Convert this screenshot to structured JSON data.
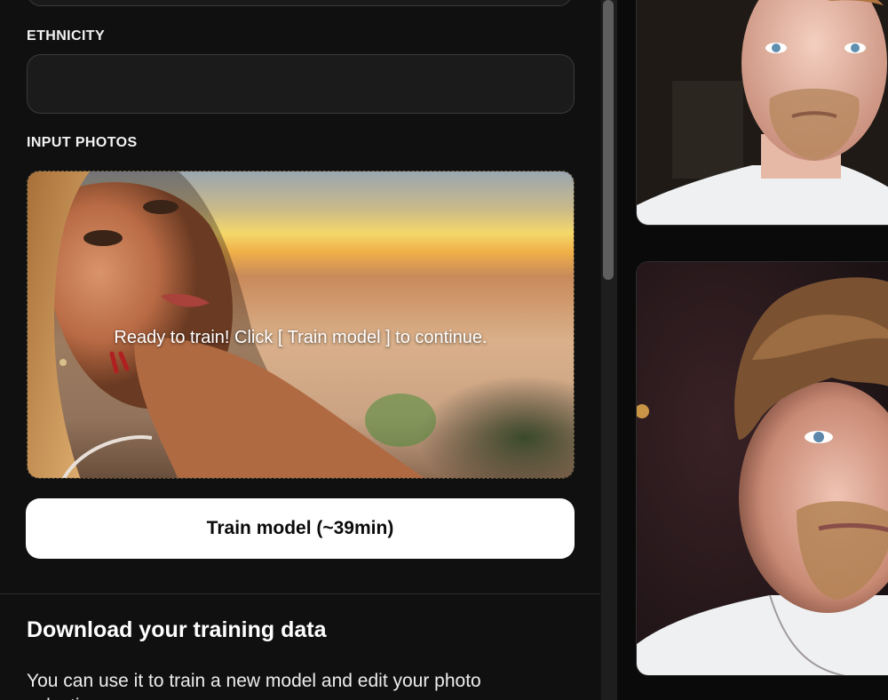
{
  "form": {
    "ethnicity_label": "ETHNICITY",
    "ethnicity_value": "",
    "input_photos_label": "INPUT PHOTOS",
    "dropzone_message": "Ready to train! Click [ Train model ] to continue.",
    "train_button_label": "Train model (~39min)"
  },
  "download_section": {
    "title": "Download your training data",
    "body": "You can use it to train a new model and edit your photo selection"
  },
  "colors": {
    "background": "#0b0b0b",
    "panel": "#101010",
    "button_bg": "#ffffff",
    "button_text": "#0b0b0b"
  }
}
